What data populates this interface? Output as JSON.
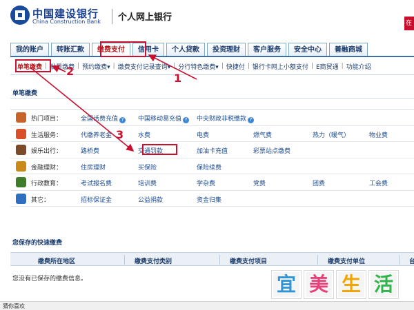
{
  "header": {
    "bank_name_cn": "中国建设银行",
    "bank_name_en": "China Construction Bank",
    "site_name": "个人网上银行",
    "right_button": "在"
  },
  "main_tabs": [
    {
      "label": "我的账户",
      "active": false
    },
    {
      "label": "转账汇款",
      "active": false
    },
    {
      "label": "缴费支付",
      "active": true
    },
    {
      "label": "信用卡",
      "active": false
    },
    {
      "label": "个人贷款",
      "active": false
    },
    {
      "label": "投资理财",
      "active": false
    },
    {
      "label": "客户服务",
      "active": false
    },
    {
      "label": "安全中心",
      "active": false
    },
    {
      "label": "善融商城",
      "active": false
    }
  ],
  "sub_nav": [
    {
      "label": "单笔缴费",
      "active": true
    },
    {
      "label": "批量缴费",
      "active": false
    },
    {
      "label": "预约缴费▾",
      "active": false
    },
    {
      "label": "缴费支付记录查询▾",
      "active": false
    },
    {
      "label": "分行特色缴费▾",
      "active": false
    },
    {
      "label": "快捷付",
      "active": false
    },
    {
      "label": "银行卡网上小额支付",
      "active": false
    },
    {
      "label": "E商贸通",
      "active": false
    },
    {
      "label": "功能介绍",
      "active": false
    }
  ],
  "section1": {
    "title": "单笔缴费"
  },
  "categories": [
    {
      "label": "热门项目：",
      "icon": "hot-icon",
      "icon_color": "#c8642a",
      "links": [
        "全国话费充值",
        "中国移动易充值",
        "中央财政非税缴款"
      ],
      "info_flags": [
        true,
        true,
        true
      ]
    },
    {
      "label": "生活服务：",
      "icon": "life-icon",
      "icon_color": "#d94f2a",
      "links": [
        "代缴养老金",
        "水费",
        "电费",
        "燃气费",
        "热力（暖气）",
        "物业费"
      ],
      "info_flags": [
        false,
        false,
        false,
        false,
        false,
        false
      ]
    },
    {
      "label": "娱乐出行：",
      "icon": "travel-icon",
      "icon_color": "#7a4a2a",
      "links": [
        "路桥费",
        "交通罚款",
        "加油卡充值",
        "彩票站点缴费"
      ],
      "info_flags": [
        false,
        false,
        false,
        false
      ]
    },
    {
      "label": "金融理财：",
      "icon": "finance-icon",
      "icon_color": "#c98a1a",
      "links": [
        "住房理财",
        "买保险",
        "保险续费"
      ],
      "info_flags": [
        false,
        false,
        false
      ]
    },
    {
      "label": "行政教育：",
      "icon": "edu-icon",
      "icon_color": "#3f7d2a",
      "links": [
        "考试报名费",
        "培训费",
        "学杂费",
        "党费",
        "团费",
        "工会费"
      ],
      "info_flags": [
        false,
        false,
        false,
        false,
        false,
        false
      ]
    },
    {
      "label": "其它：",
      "icon": "other-icon",
      "icon_color": "#2f6fc2",
      "links": [
        "招标保证金",
        "公益捐款",
        "资金归集"
      ],
      "info_flags": [
        false,
        false,
        false
      ]
    }
  ],
  "section2": {
    "title": "您保存的快速缴费",
    "columns": [
      "缴费所在地区",
      "缴费支付类别",
      "缴费支付项目",
      "缴费支付单位",
      "台"
    ],
    "empty_text": "您没有已保存的缴费信息。"
  },
  "status_bar": {
    "text": "猜你喜欢"
  },
  "watermark": {
    "chars": [
      "宜",
      "美",
      "生",
      "活"
    ],
    "colors": [
      "#2f95d6",
      "#e6427a",
      "#f0a500",
      "#2fb34a"
    ]
  },
  "annotations": {
    "labels": [
      "1",
      "2",
      "3"
    ],
    "color": "#c8102e"
  }
}
